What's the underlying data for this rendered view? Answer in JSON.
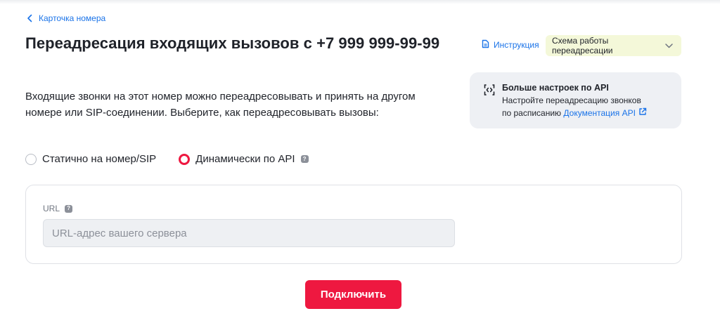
{
  "breadcrumb": {
    "back_label": "Карточка номера"
  },
  "page": {
    "title": "Переадресация входящих вызовов с +7 999 999-99-99"
  },
  "header_actions": {
    "instruction_label": "Инструкция",
    "scheme_label": "Схема работы переадресации"
  },
  "description": "Входящие звонки на этот номер можно переадресовывать и принять на другом номере или SIP-соединении. Выберите, как переадресовывать вызовы:",
  "api_card": {
    "title": "Больше настроек по API",
    "line1": "Настройте переадресацию звонков",
    "line2": "по расписанию",
    "link_label": "Документация API"
  },
  "forwarding_mode": {
    "options": [
      {
        "label": "Статично на номер/SIP",
        "selected": false
      },
      {
        "label": "Динамически по API",
        "selected": true
      }
    ]
  },
  "url_field": {
    "label": "URL",
    "value": "",
    "placeholder": "URL-адрес вашего сервера"
  },
  "connect_button": {
    "label": "Подключить"
  },
  "colors": {
    "accent_red": "#ee1840",
    "link_blue": "#1a73e8",
    "scheme_bg": "#f4f8d9",
    "card_bg": "#eef0f4"
  },
  "icons": {
    "back": "chevron-left-icon",
    "instruction": "document-icon",
    "scheme_toggle": "chevron-down-icon",
    "api": "code-icon",
    "external_link": "external-link-icon",
    "help": "question-icon"
  }
}
